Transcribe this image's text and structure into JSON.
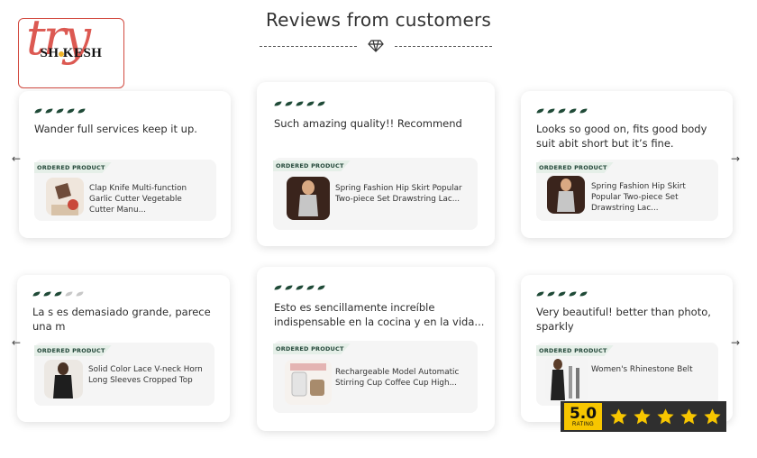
{
  "header": {
    "title": "Reviews from customers"
  },
  "logo": {
    "script_text": "try",
    "brand_text": "SH KESH"
  },
  "ordered_product_label": "ORDERED PRODUCT",
  "star_color": "#1f4a37",
  "star_empty_color": "#c8c8c8",
  "reviews": [
    {
      "stars": 5,
      "text": "Wander full services keep it up.",
      "product": "Clap Knife Multi-function Garlic Cutter Vegetable Cutter Manu..."
    },
    {
      "stars": 5,
      "text": "Such amazing quality!! Recommend",
      "product": "Spring Fashion Hip Skirt Popular Two-piece Set Drawstring Lac..."
    },
    {
      "stars": 5,
      "text": "Looks so good on, fits good body suit abit short but it’s fine.",
      "product": "Spring Fashion Hip Skirt Popular Two-piece Set Drawstring Lac..."
    },
    {
      "stars": 3,
      "text": "La s es demasiado grande, parece una m",
      "product": "Solid Color Lace V-neck Horn Long Sleeves Cropped Top"
    },
    {
      "stars": 5,
      "text": "Esto es sencillamente increíble indispensable en la cocina y en la vida...",
      "product": "Rechargeable Model Automatic Stirring Cup Coffee Cup High..."
    },
    {
      "stars": 5,
      "text": "Very beautiful! better than photo, sparkly",
      "product": "Women's Rhinestone Belt"
    }
  ],
  "navigation": {
    "prev": "←",
    "next": "→"
  },
  "rating_badge": {
    "value": "5.0",
    "label": "RATING",
    "stars": 5,
    "star_color": "#f7c600"
  }
}
